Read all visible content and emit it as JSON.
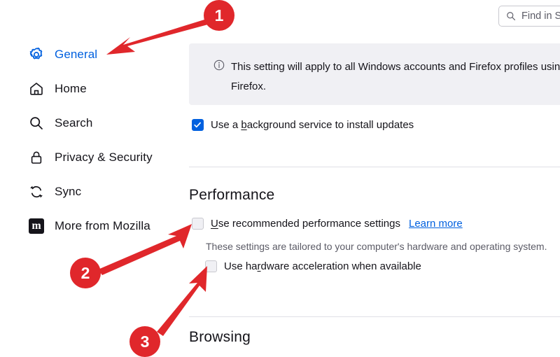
{
  "search": {
    "placeholder": "Find in S",
    "icon": "search-icon"
  },
  "sidebar": {
    "items": [
      {
        "label": "General",
        "icon": "gear-icon",
        "selected": true
      },
      {
        "label": "Home",
        "icon": "home-icon",
        "selected": false
      },
      {
        "label": "Search",
        "icon": "magnifier-icon",
        "selected": false
      },
      {
        "label": "Privacy & Security",
        "icon": "lock-icon",
        "selected": false
      },
      {
        "label": "Sync",
        "icon": "sync-icon",
        "selected": false
      },
      {
        "label": "More from Mozilla",
        "icon": "mozilla-m-icon",
        "selected": false
      }
    ],
    "mozilla_glyph": "m"
  },
  "main": {
    "banner": {
      "icon": "info-circle-icon",
      "text": "This setting will apply to all Windows accounts and Firefox profiles usin\nFirefox."
    },
    "background_update": {
      "label_before": "Use a ",
      "label_accesskey": "b",
      "label_after": "ackground service to install updates",
      "checked": true
    },
    "performance": {
      "title": "Performance",
      "recommended": {
        "label_before": "",
        "label_accesskey": "U",
        "label_after": "se recommended performance settings",
        "checked": false,
        "learn_more": "Learn more"
      },
      "hint": "These settings are tailored to your computer's hardware and operating system.",
      "hardware_acceleration": {
        "label_before": "Use ha",
        "label_accesskey": "r",
        "label_after": "dware acceleration when available",
        "checked": false
      }
    },
    "browsing": {
      "title": "Browsing"
    }
  },
  "annotations": {
    "badges": [
      {
        "number": "1"
      },
      {
        "number": "2"
      },
      {
        "number": "3"
      }
    ],
    "color": "#e0272b"
  }
}
